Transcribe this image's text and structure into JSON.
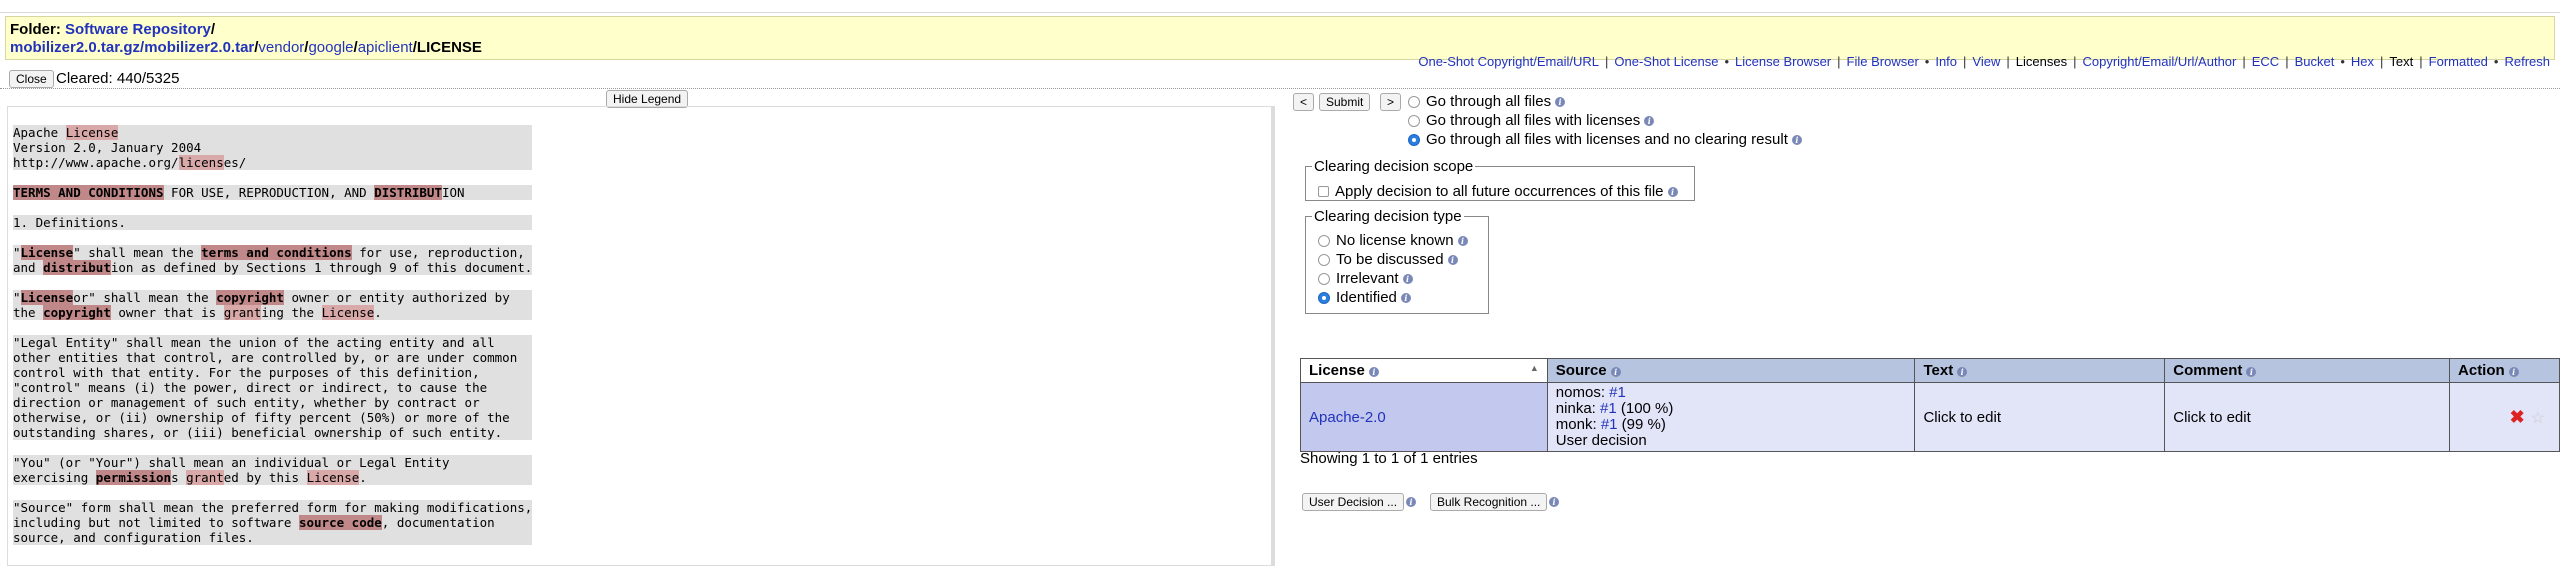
{
  "folder": {
    "label": "Folder:",
    "root": "Software Repository",
    "sep": "/",
    "path": [
      {
        "text": "mobilizer2.0.tar.gz/mobilizer2.0.tar",
        "bold": true
      },
      {
        "text": "vendor",
        "bold": false
      },
      {
        "text": "google",
        "bold": false
      },
      {
        "text": "apiclient",
        "bold": false
      }
    ],
    "current": "LICENSE"
  },
  "top_links": {
    "oneshot_copyright": "One-Shot Copyright/Email/URL",
    "oneshot_license": "One-Shot License",
    "license_browser": "License Browser",
    "file_browser": "File Browser",
    "info": "Info",
    "view": "View",
    "licenses": "Licenses",
    "copyright": "Copyright/Email/Url/Author",
    "ecc": "ECC",
    "bucket": "Bucket",
    "hex": "Hex",
    "text": "Text",
    "formatted": "Formatted",
    "refresh": "Refresh",
    "bar": "|",
    "bullet": "•"
  },
  "close_label": "Close",
  "cleared": "Cleared: 440/5325",
  "hide_legend_label": "Hide Legend",
  "license_text": [
    [
      [
        "Apache ",
        ""
      ],
      [
        "License",
        "k"
      ],
      [
        "\nVersion 2.0, January 2004\nhttp://www.apache.org/",
        ""
      ],
      [
        "licens",
        "k"
      ],
      [
        "es/",
        ""
      ]
    ],
    [
      [
        "TERMS AND CONDITIONS",
        "kb"
      ],
      [
        " FOR USE, REPRODUCTION, AND ",
        ""
      ],
      [
        "DISTRIBUT",
        "kb"
      ],
      [
        "ION",
        ""
      ]
    ],
    [
      [
        "1. Definitions.",
        ""
      ]
    ],
    [
      [
        "\"",
        ""
      ],
      [
        "License",
        "kb"
      ],
      [
        "\" shall mean the ",
        ""
      ],
      [
        "terms and conditions",
        "kb"
      ],
      [
        " for use, reproduction,\nand ",
        ""
      ],
      [
        "distribut",
        "kb"
      ],
      [
        "ion as defined by Sections 1 through 9 of this document.",
        ""
      ]
    ],
    [
      [
        "\"",
        ""
      ],
      [
        "License",
        "kb"
      ],
      [
        "or\" shall mean the ",
        ""
      ],
      [
        "copyright",
        "kb"
      ],
      [
        " owner or entity authorized by\nthe ",
        ""
      ],
      [
        "copyright",
        "kb"
      ],
      [
        " owner that is ",
        ""
      ],
      [
        "grant",
        "k"
      ],
      [
        "ing the ",
        ""
      ],
      [
        "License",
        "k"
      ],
      [
        ".",
        ""
      ]
    ],
    [
      [
        "\"Legal Entity\" shall mean the union of the acting entity and all\nother entities that control, are controlled by, or are under common\ncontrol with that entity. For the purposes of this definition,\n\"control\" means (i) the power, direct or indirect, to cause the\ndirection or management of such entity, whether by contract or\notherwise, or (ii) ownership of fifty percent (50%) or more of the\noutstanding shares, or (iii) beneficial ownership of such entity.",
        ""
      ]
    ],
    [
      [
        "\"You\" (or \"Your\") shall mean an individual or Legal Entity\nexercising ",
        ""
      ],
      [
        "permission",
        "kb"
      ],
      [
        "s ",
        ""
      ],
      [
        "grant",
        "k"
      ],
      [
        "ed by this ",
        ""
      ],
      [
        "License",
        "k"
      ],
      [
        ".",
        ""
      ]
    ],
    [
      [
        "\"Source\" form shall mean the preferred form for making modifications,\nincluding but not limited to software ",
        ""
      ],
      [
        "source code",
        "kb"
      ],
      [
        ", documentation\nsource, and configuration files.",
        ""
      ]
    ]
  ],
  "nav": {
    "prev": "<",
    "submit": "Submit",
    "next": ">"
  },
  "go_options": [
    {
      "label": "Go through all files",
      "checked": false
    },
    {
      "label": "Go through all files with licenses",
      "checked": false
    },
    {
      "label": "Go through all files with licenses and no clearing result",
      "checked": true
    }
  ],
  "scope": {
    "legend": "Clearing decision scope",
    "option": "Apply decision to all future occurrences of this file"
  },
  "decision_type": {
    "legend": "Clearing decision type",
    "options": [
      {
        "label": "No license known",
        "checked": false
      },
      {
        "label": "To be discussed",
        "checked": false
      },
      {
        "label": "Irrelevant",
        "checked": false
      },
      {
        "label": "Identified",
        "checked": true
      }
    ]
  },
  "table": {
    "headers": [
      "License",
      "Source",
      "Text",
      "Comment",
      "Action"
    ],
    "sort_indicator": "▲",
    "row": {
      "license": "Apache-2.0",
      "source": [
        {
          "agent": "nomos:",
          "link": "#1",
          "pct": ""
        },
        {
          "agent": "ninka:",
          "link": "#1",
          "pct": " (100 %)"
        },
        {
          "agent": "monk:",
          "link": "#1",
          "pct": " (99 %)"
        }
      ],
      "source_note": "User decision",
      "text": "Click to edit",
      "comment": "Click to edit",
      "delete_glyph": "✖",
      "star_glyph": "☆"
    }
  },
  "showing": "Showing 1 to 1 of 1 entries",
  "buttons": {
    "user_decision": "User Decision ...",
    "bulk_recognition": "Bulk Recognition ..."
  },
  "info_glyph": "i",
  "colors": {
    "folder_bg": "#ffffcc",
    "link": "#2233bb",
    "header_bg": "#b6c4e0",
    "row_bg": "#e2e4f8",
    "highlight": "#d9a8a8",
    "radio_on": "#2a7fe0",
    "delete": "#dd2222"
  }
}
